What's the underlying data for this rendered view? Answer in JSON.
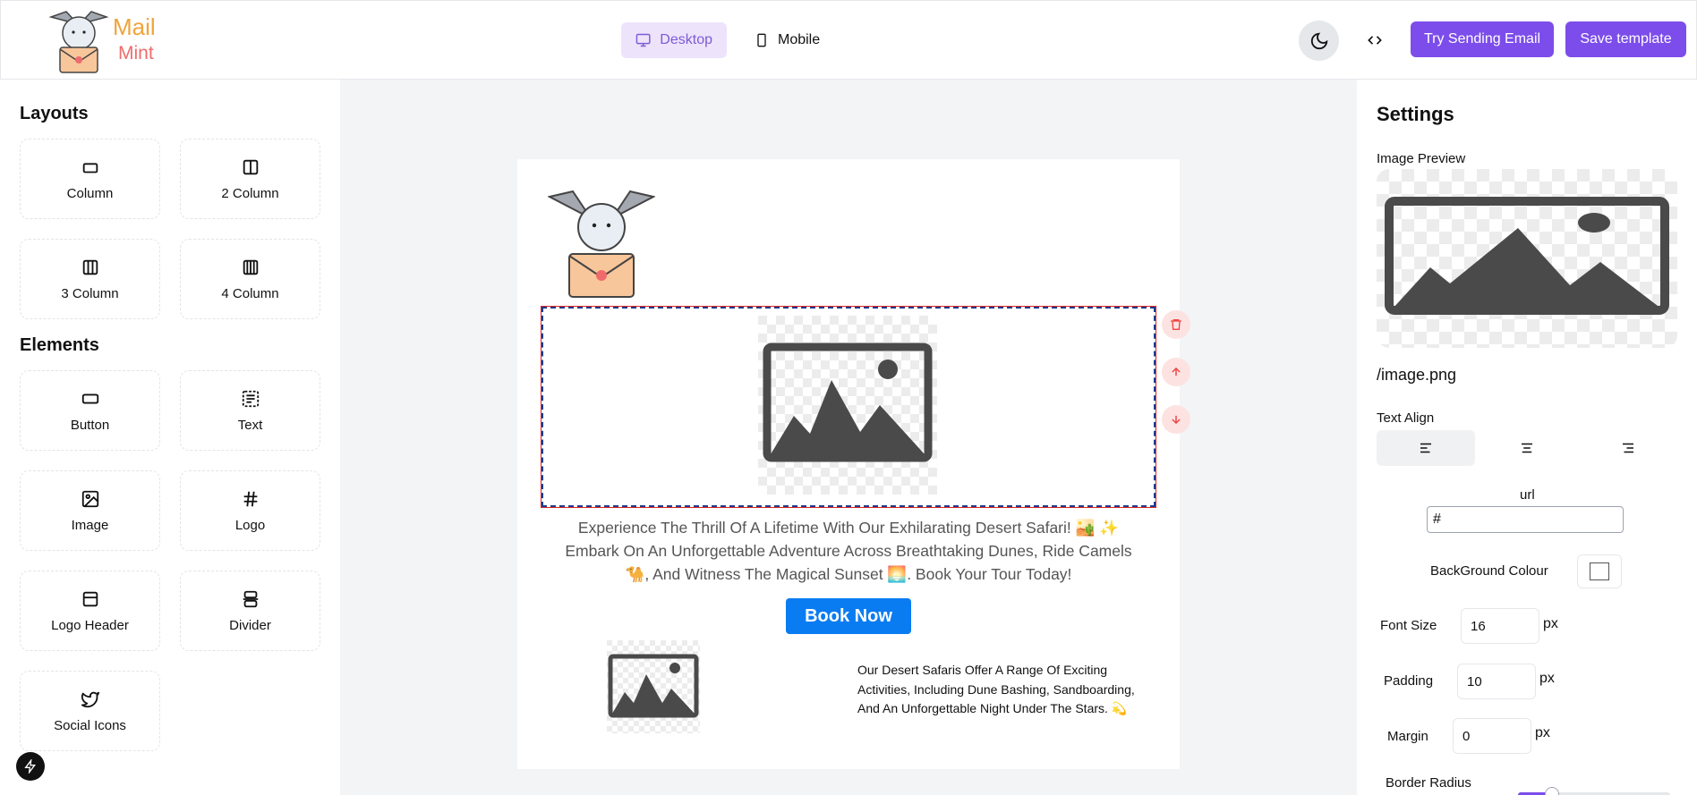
{
  "header": {
    "logo_word_1": "Mail",
    "logo_word_2": "Mint",
    "view_desktop": "Desktop",
    "view_mobile": "Mobile",
    "try_email": "Try Sending Email",
    "save_template": "Save template"
  },
  "left": {
    "layouts_title": "Layouts",
    "elements_title": "Elements",
    "layouts": [
      {
        "label": "Column",
        "icon": "column-icon"
      },
      {
        "label": "2 Column",
        "icon": "two-column-icon"
      },
      {
        "label": "3 Column",
        "icon": "three-column-icon"
      },
      {
        "label": "4 Column",
        "icon": "four-column-icon"
      }
    ],
    "elements": [
      {
        "label": "Button",
        "icon": "button-icon"
      },
      {
        "label": "Text",
        "icon": "text-icon"
      },
      {
        "label": "Image",
        "icon": "image-icon"
      },
      {
        "label": "Logo",
        "icon": "hash-icon"
      },
      {
        "label": "Logo Header",
        "icon": "logo-header-icon"
      },
      {
        "label": "Divider",
        "icon": "divider-icon"
      },
      {
        "label": "Social Icons",
        "icon": "twitter-icon"
      }
    ]
  },
  "email": {
    "body_text": "Experience The Thrill Of A Lifetime With Our Exhilarating Desert Safari! 🏜️ ✨ Embark On An Unforgettable Adventure Across Breathtaking Dunes, Ride Camels 🐪, And Witness The Magical Sunset 🌅. Book Your Tour Today!",
    "button_label": "Book Now",
    "side_text": "Our Desert Safaris Offer A Range Of Exciting Activities, Including Dune Bashing, Sandboarding, And An Unforgettable Night Under The Stars. 💫"
  },
  "settings": {
    "title": "Settings",
    "image_preview_label": "Image Preview",
    "image_path": "/image.png",
    "text_align_label": "Text Align",
    "text_align_value": "left",
    "url_label": "url",
    "url_value": "#",
    "bg_label": "BackGround Colour",
    "bg_color": "#ffffff",
    "font_size_label": "Font Size",
    "font_size_value": "16",
    "padding_label": "Padding",
    "padding_value": "10",
    "margin_label": "Margin",
    "margin_value": "0",
    "unit_px": "px",
    "border_radius_label": "Border Radius"
  },
  "colors": {
    "accent": "#7c4dea",
    "book_button": "#0a7cf2",
    "desktop_tab_bg": "#ede3fb"
  }
}
